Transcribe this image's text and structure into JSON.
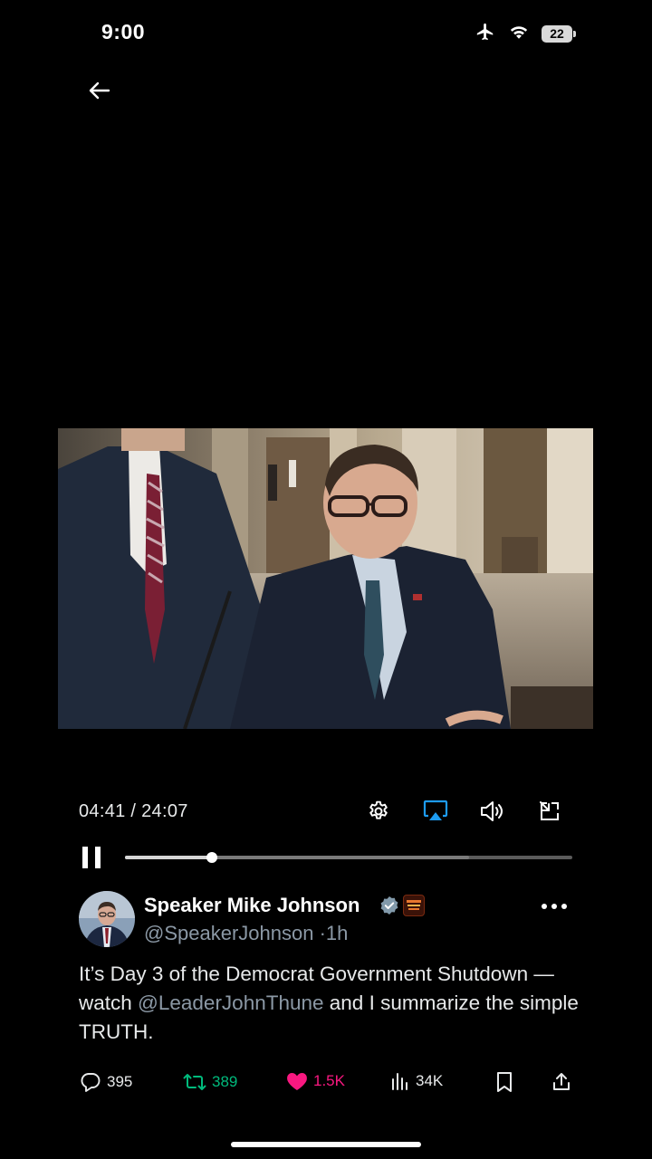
{
  "status_bar": {
    "time": "9:00",
    "battery": "22",
    "icons": [
      "airplane-icon",
      "wifi-icon",
      "battery-icon"
    ]
  },
  "video": {
    "time_display": "04:41 / 24:07",
    "progress_fraction": 0.194,
    "buffered_fraction": 0.77,
    "controls": [
      "settings-icon",
      "airplay-icon",
      "volume-icon",
      "minimize-icon"
    ],
    "airplay_color": "#1d9bf0"
  },
  "tweet": {
    "display_name": "Speaker Mike Johnson",
    "handle": "@SpeakerJohnson",
    "separator": "·",
    "age": "1h",
    "text_before": "It’s Day 3 of the Democrat Government Shutdown — watch ",
    "mention": "@LeaderJohnThune",
    "text_after": " and I summarize the simple TRUTH.",
    "actions": {
      "replies": "395",
      "reposts": "389",
      "likes": "1.5K",
      "views": "34K"
    },
    "colors": {
      "repost": "#00ba7c",
      "like": "#f91880",
      "default": "#8b98a5"
    }
  }
}
